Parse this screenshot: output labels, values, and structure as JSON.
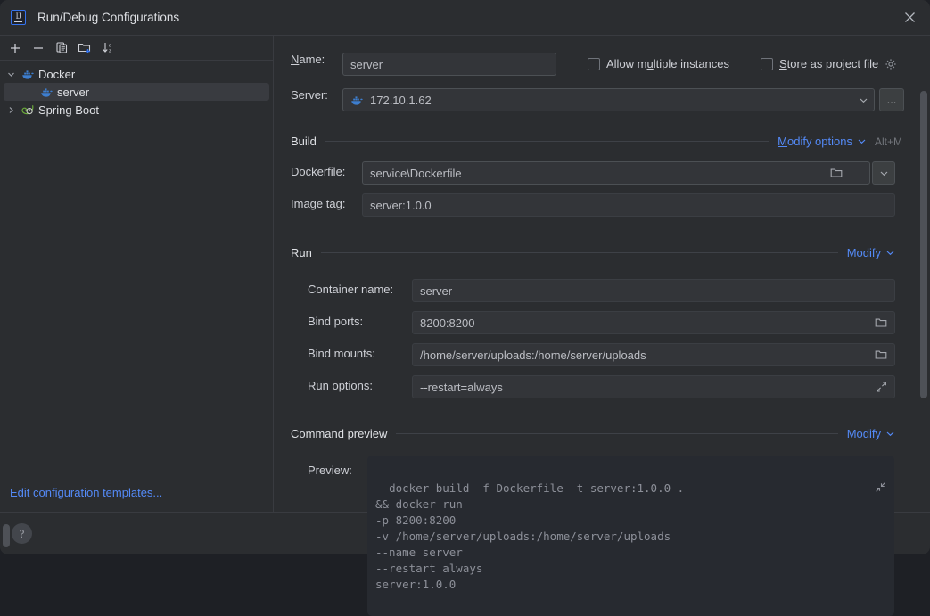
{
  "window": {
    "title": "Run/Debug Configurations",
    "logo_text": "IJ",
    "close_icon": "close-icon"
  },
  "sidebar": {
    "toolbar": [
      {
        "name": "add-configuration-button",
        "icon": "plus-icon"
      },
      {
        "name": "remove-configuration-button",
        "icon": "minus-icon"
      },
      {
        "name": "copy-configuration-button",
        "icon": "copy-icon"
      },
      {
        "name": "new-folder-button",
        "icon": "new-folder-icon"
      },
      {
        "name": "sort-configurations-button",
        "icon": "sort-alpha-down-icon"
      }
    ],
    "tree": [
      {
        "label": "Docker",
        "icon": "docker-whale-icon",
        "expanded": true,
        "level": 0,
        "selected": false
      },
      {
        "label": "server",
        "icon": "docker-whale-icon",
        "level": 1,
        "selected": true
      },
      {
        "label": "Spring Boot",
        "icon": "spring-leaf-icon",
        "expanded": false,
        "level": 0,
        "selected": false
      }
    ],
    "edit_templates_link": "Edit configuration templates..."
  },
  "form": {
    "name_label": "Name:",
    "name_mnemonic": "N",
    "name_value": "server",
    "allow_multiple_instances": {
      "label_before": "Allow m",
      "label_mnemonic": "u",
      "label_after": "ltiple instances",
      "checked": false
    },
    "store_as_project_file": {
      "label_mnemonic": "S",
      "label_after": "tore as project file",
      "checked": false,
      "gear_icon": "gear-icon"
    },
    "server_label": "Server:",
    "server_value": "172.10.1.62",
    "server_icon": "docker-whale-icon",
    "server_browse_label": "...",
    "build": {
      "title": "Build",
      "modify_link_mnemonic": "M",
      "modify_link_rest": "odify options",
      "shortcut": "Alt+M",
      "dockerfile_label": "Dockerfile:",
      "dockerfile_value": "service\\Dockerfile",
      "image_tag_label": "Image tag:",
      "image_tag_value": "server:1.0.0"
    },
    "run": {
      "title": "Run",
      "modify_link": "Modify",
      "container_name_label": "Container name:",
      "container_name_value": "server",
      "bind_ports_label": "Bind ports:",
      "bind_ports_value": "8200:8200",
      "bind_mounts_label": "Bind mounts:",
      "bind_mounts_value": "/home/server/uploads:/home/server/uploads",
      "run_options_label": "Run options:",
      "run_options_value": "--restart=always"
    },
    "command_preview": {
      "title": "Command preview",
      "modify_link": "Modify",
      "preview_label": "Preview:",
      "preview_text": "docker build -f Dockerfile -t server:1.0.0 .\n&& docker run\n-p 8200:8200\n-v /home/server/uploads:/home/server/uploads\n--name server\n--restart always\nserver:1.0.0"
    }
  },
  "footer": {
    "help_label": "?"
  },
  "colors": {
    "accent_link": "#548af7",
    "docker_blue": "#3d7ecf",
    "spring_green": "#6cab3a",
    "dialog_bg": "#2b2d30",
    "field_bg": "#333539",
    "selection_bg": "#393b40"
  }
}
